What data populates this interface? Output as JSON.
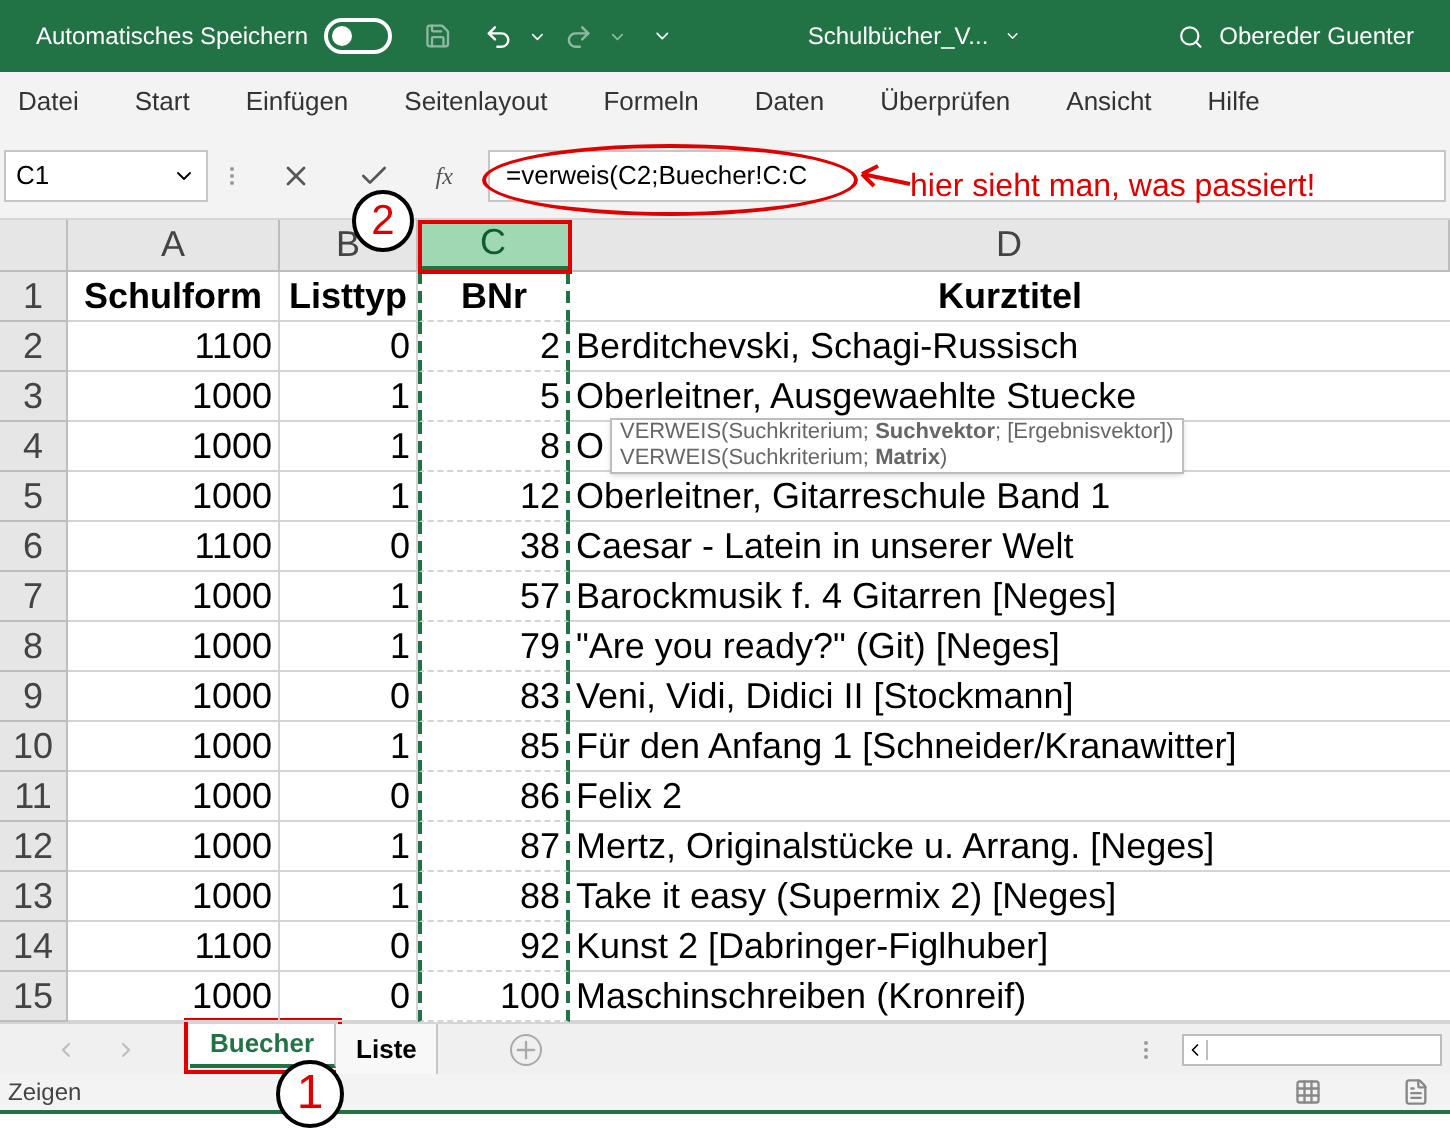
{
  "title_bar": {
    "autosave_label": "Automatisches Speichern",
    "autosave_on": false,
    "filename": "Schulbücher_V...",
    "user": "Obereder Guenter"
  },
  "menu": [
    {
      "label": "Datei"
    },
    {
      "label": "Start"
    },
    {
      "label": "Einfügen"
    },
    {
      "label": "Seitenlayout"
    },
    {
      "label": "Formeln"
    },
    {
      "label": "Daten"
    },
    {
      "label": "Überprüfen"
    },
    {
      "label": "Ansicht"
    },
    {
      "label": "Hilfe"
    }
  ],
  "formula_bar": {
    "name_box": "C1",
    "fx_label": "fx",
    "formula": "=verweis(C2;Buecher!C:C"
  },
  "columns": [
    {
      "label": "A",
      "selected": false
    },
    {
      "label": "B",
      "selected": false
    },
    {
      "label": "C",
      "selected": true
    },
    {
      "label": "D",
      "selected": false
    }
  ],
  "rows": [
    {
      "number": "1",
      "cells": [
        "Schulform",
        "Listtyp",
        "BNr",
        "Kurztitel"
      ]
    },
    {
      "number": "2",
      "cells": [
        "1100",
        "0",
        "2",
        "Berditchevski, Schagi-Russisch"
      ]
    },
    {
      "number": "3",
      "cells": [
        "1000",
        "1",
        "5",
        "Oberleitner, Ausgewaehlte Stuecke"
      ]
    },
    {
      "number": "4",
      "cells": [
        "1000",
        "1",
        "8",
        "O"
      ]
    },
    {
      "number": "5",
      "cells": [
        "1000",
        "1",
        "12",
        "Oberleitner, Gitarreschule Band 1"
      ]
    },
    {
      "number": "6",
      "cells": [
        "1100",
        "0",
        "38",
        "Caesar - Latein in unserer Welt"
      ]
    },
    {
      "number": "7",
      "cells": [
        "1000",
        "1",
        "57",
        "Barockmusik f. 4 Gitarren [Neges]"
      ]
    },
    {
      "number": "8",
      "cells": [
        "1000",
        "1",
        "79",
        "\"Are you ready?\" (Git) [Neges]"
      ]
    },
    {
      "number": "9",
      "cells": [
        "1000",
        "0",
        "83",
        "Veni, Vidi, Didici II [Stockmann]"
      ]
    },
    {
      "number": "10",
      "cells": [
        "1000",
        "1",
        "85",
        "Für den Anfang 1 [Schneider/Kranawitter]"
      ]
    },
    {
      "number": "11",
      "cells": [
        "1000",
        "0",
        "86",
        "Felix 2"
      ]
    },
    {
      "number": "12",
      "cells": [
        "1000",
        "1",
        "87",
        "Mertz, Originalstücke u. Arrang. [Neges]"
      ]
    },
    {
      "number": "13",
      "cells": [
        "1000",
        "1",
        "88",
        "Take it easy (Supermix 2) [Neges]"
      ]
    },
    {
      "number": "14",
      "cells": [
        "1100",
        "0",
        "92",
        "Kunst 2 [Dabringer-Figlhuber]"
      ]
    },
    {
      "number": "15",
      "cells": [
        "1000",
        "0",
        "100",
        "Maschinschreiben (Kronreif)"
      ]
    }
  ],
  "tooltip": [
    "VERWEIS(Suchkriterium; **Suchvektor**; [Ergebnisvektor])",
    "VERWEIS(Suchkriterium; **Matrix**)"
  ],
  "sheet_tabs": [
    {
      "label": "Buecher",
      "selected": true,
      "framed": true
    },
    {
      "label": "Liste",
      "selected": false,
      "framed": false
    }
  ],
  "status_bar": "Zeigen",
  "annotations": {
    "callout": "hier sieht man, was passiert!",
    "markers": [
      "2",
      "1"
    ]
  }
}
